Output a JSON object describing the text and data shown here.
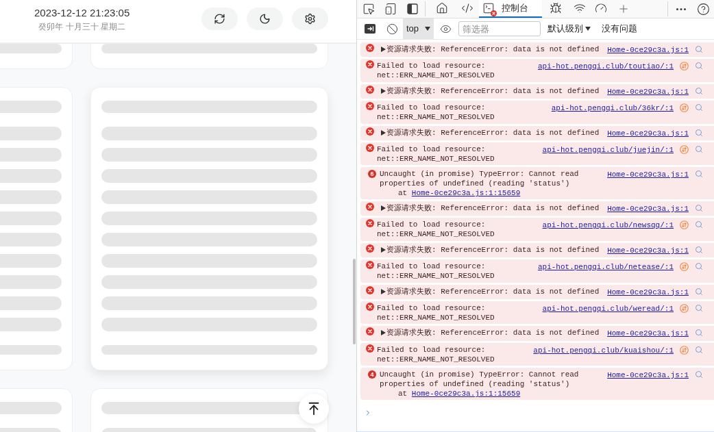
{
  "header": {
    "datetime": "2023-12-12 21:23:05",
    "lunar_date": "癸卯年 十月三十 星期二"
  },
  "feed": {
    "cards": [
      {
        "loading": true,
        "hovered": false
      },
      {
        "loading": true,
        "hovered": false
      },
      {
        "loading": true,
        "hovered": false
      },
      {
        "loading": true,
        "hovered": true
      },
      {
        "loading": true,
        "hovered": false
      },
      {
        "loading": true,
        "hovered": false
      }
    ]
  },
  "devtools": {
    "tabs": [
      {
        "kind": "welcome",
        "selected": false,
        "has_errors": false
      },
      {
        "kind": "elements",
        "selected": false,
        "has_errors": false
      },
      {
        "kind": "console",
        "label": "控制台",
        "selected": true,
        "has_errors": true
      },
      {
        "kind": "sources",
        "selected": false,
        "has_errors": false
      },
      {
        "kind": "network",
        "selected": false,
        "has_errors": false
      },
      {
        "kind": "performance",
        "selected": false,
        "has_errors": false
      }
    ],
    "console_toolbar": {
      "context": "top",
      "filter_placeholder": "筛选器",
      "log_levels": "默认级别",
      "issues": "没有问题"
    },
    "messages": [
      {
        "kind": "error",
        "expanded": false,
        "text": "资源请求失败: ReferenceError: data is not defined",
        "source": "Home-0ce29c3a.js:1"
      },
      {
        "kind": "network",
        "text": "Failed to load resource: net::ERR_NAME_NOT_RESOLVED",
        "source": "api-hot.pengqi.club/toutiao/:1"
      },
      {
        "kind": "error",
        "expanded": false,
        "text": "资源请求失败: ReferenceError: data is not defined",
        "source": "Home-0ce29c3a.js:1"
      },
      {
        "kind": "network",
        "text": "Failed to load resource: net::ERR_NAME_NOT_RESOLVED",
        "source": "api-hot.pengqi.club/36kr/:1"
      },
      {
        "kind": "error",
        "expanded": false,
        "text": "资源请求失败: ReferenceError: data is not defined",
        "source": "Home-0ce29c3a.js:1"
      },
      {
        "kind": "network",
        "text": "Failed to load resource: net::ERR_NAME_NOT_RESOLVED",
        "source": "api-hot.pengqi.club/juejin/:1"
      },
      {
        "kind": "uncaught",
        "count": "6",
        "text": "Uncaught (in promise) TypeError: Cannot read properties of undefined (reading 'status')",
        "stack_prefix": "at",
        "stack_source": "Home-0ce29c3a.js:1:15659",
        "source": "Home-0ce29c3a.js:1"
      },
      {
        "kind": "error",
        "expanded": false,
        "text": "资源请求失败: ReferenceError: data is not defined",
        "source": "Home-0ce29c3a.js:1"
      },
      {
        "kind": "network",
        "text": "Failed to load resource: net::ERR_NAME_NOT_RESOLVED",
        "source": "api-hot.pengqi.club/newsqq/:1"
      },
      {
        "kind": "error",
        "expanded": false,
        "text": "资源请求失败: ReferenceError: data is not defined",
        "source": "Home-0ce29c3a.js:1"
      },
      {
        "kind": "network",
        "text": "Failed to load resource: net::ERR_NAME_NOT_RESOLVED",
        "source": "api-hot.pengqi.club/netease/:1"
      },
      {
        "kind": "error",
        "expanded": false,
        "text": "资源请求失败: ReferenceError: data is not defined",
        "source": "Home-0ce29c3a.js:1"
      },
      {
        "kind": "network",
        "text": "Failed to load resource: net::ERR_NAME_NOT_RESOLVED",
        "source": "api-hot.pengqi.club/weread/:1"
      },
      {
        "kind": "error",
        "expanded": false,
        "text": "资源请求失败: ReferenceError: data is not defined",
        "source": "Home-0ce29c3a.js:1"
      },
      {
        "kind": "network",
        "text": "Failed to load resource: net::ERR_NAME_NOT_RESOLVED",
        "source": "api-hot.pengqi.club/kuaishou/:1"
      },
      {
        "kind": "uncaught",
        "count": "4",
        "text": "Uncaught (in promise) TypeError: Cannot read properties of undefined (reading 'status')",
        "stack_prefix": "at",
        "stack_source": "Home-0ce29c3a.js:1:15659",
        "source": "Home-0ce29c3a.js:1"
      }
    ]
  }
}
